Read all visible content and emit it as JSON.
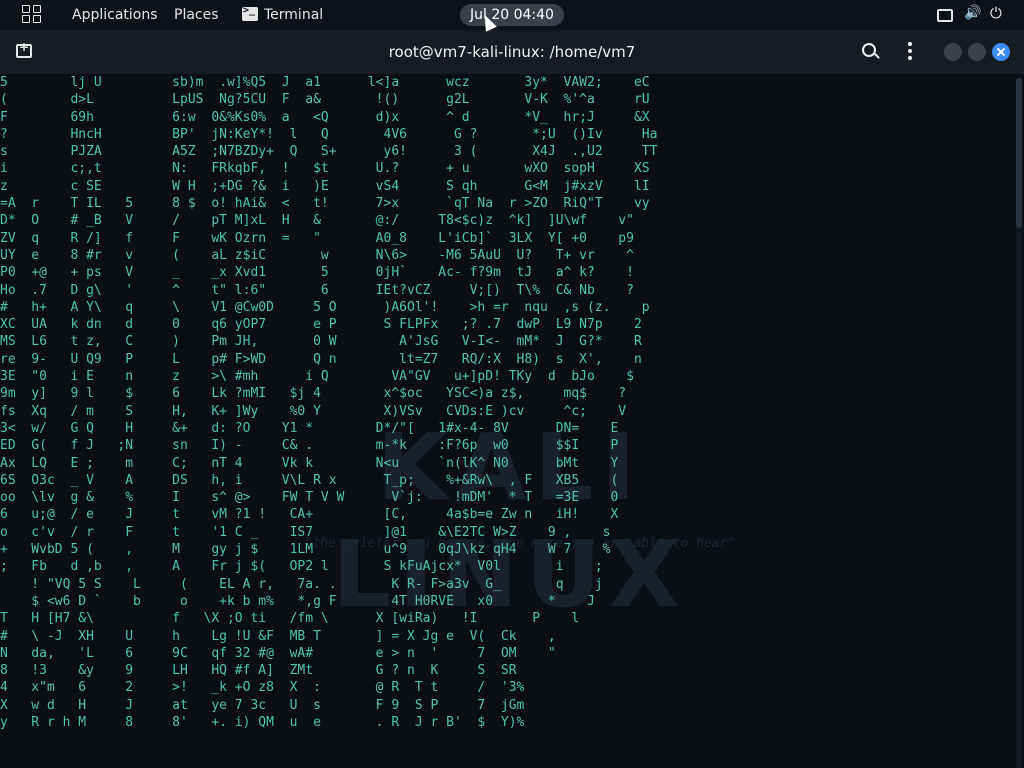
{
  "topbar": {
    "applications": "Applications",
    "places": "Places",
    "terminal_app": "Terminal",
    "clock": "Jul 20  04:40"
  },
  "window": {
    "title": "root@vm7-kali-linux: /home/vm7"
  },
  "terminal": {
    "watermark": "KALI LINUX",
    "watermark_sub": "\"the quieter you become, the more you are able to hear\"",
    "matrix_rows": [
      "5        lj U         sb)m  .w]%Q5  J  a1      l<]a      wcz       3y*  VAW2;    eC",
      "(        d>L          LpUS  Ng?5CU  F  a&       !()      g2L       V-K  %'^a     rU",
      "F        69h          6:w  0&%Ks0%  a   <Q      d)x      ^ d       *V_  hr;J     &X",
      "?        HncH         BP'  jN:KeY*!  l   Q       4V6      G ?       *;U  ()Iv     Ha",
      "s        PJZA         A5Z  ;N7BZDy+  Q   S+      y6!      3 (       X4J  .,U2     TT",
      "i        c;,t         N:   FRkqbF,  !   $t      U.?      + u       wXO  sopH     XS",
      "z        c SE         W H  ;+DG ?&  i   )E      vS4      S qh      G<M  j#xzV    lI",
      "=A  r    T IL   5     8 $  o! hAi&  <   t!      7>x      `qT Na  r >ZO  RiQ\"T    vy",
      "D*  O    # _B   V     /    pT M]xL  H   &       @:/     T8<$c)z  ^k]  ]U\\wf    v\"",
      "ZV  q    R /]   f     F    wK Ozrn  =   \"       A0_8    L'iCb]`  3LX  Y[ +0    p9",
      "UY  e    8 #r   v     (    aL z$iC       w      N\\6>    -M6 5AuU  U?   T+ vr    ^",
      "P0  +@   + ps   V     _    _x Xvd1       5      0jH`    Ac- f?9m  tJ   a^ k?    !",
      "Ho  .7   D g\\   '     ^    t\" l:6\"       6      IEt?vCZ     V;[)  T\\%  C& Nb    ?",
      "#   h+   A Y\\   q     \\    V1 @Cw0D     5 O      )A6Ol'!    >h =r  nqu  ,s (z.    p",
      "XC  UA   k dn   d     0    q6 yOP7      e P      S FLPFx   ;? .7  dwP  L9 N7p    2",
      "MS  L6   t z,   C     )    Pm JH,       0 W        A'JsG   V-I<-  mM*  J  G?*    R",
      "re  9-   U Q9   P     L    p# F>WD      Q n        lt=Z7   RQ/:X  H8)  s  X',    n",
      "3E  \"0   i E    n     z    >\\ #mh      i Q        VA\"GV   u+]pD! TKy  d  bJo    $",
      "9m  y]   9 l    $     6    Lk ?mMI   $j 4        x^$oc   YSC<)a z$,     mq$    ?",
      "fs  Xq   / m    S     H,   K+ ]Wy    %0 Y        X)VSv   CVDs:E )cv     ^c;    V",
      "3<  w/   G Q    H     &+   d: ?O    Y1 *        D*/\"[   1#x-4- 8V      DN=    E",
      "ED  G(   f J   ;N     sn   I) -     C& .        m-*k    :F?6p  w0      $$I    P",
      "Ax  LQ   E ;    m     C;   nT 4     Vk k        N<u     `n(lK^ N0      bMt    Y",
      "6S  O3c  _ V    A     DS   h, i     V\\L R x      T_p;    %+&Rw\\  , F   XB5    (",
      "oo  \\lv  g &    %     I    s^ @>    FW T V W      V`j:    !mDM'  * T   =3E    0",
      "6   u;@  / e    J     t    vM ?1 !   CA+         [C,     4a$b=e Zw n   iH!    X",
      "o   c'v  / r    F     t    '1 C _    IS7         ]@1    &\\E2TC W>Z    9 ,    s",
      "+   WvbD 5 (    ,     M    gy j $    1LM         u^9    0qJ\\kz qH4    W 7    %",
      ";   Fb   d ,b   ,     A    Fr j $(   OP2 l       S kFuAjcx*  V0l       i    ;",
      "    ! \"VQ 5 S    L     (    EL A r,   7a. .       K R- F>a3v  G_       q    j",
      "    $ <w6 D `    b     o    +k b m%   *,g F       4T H0RVE   x0       *    J",
      "T   H [H7 &\\          f   \\X ;O ti   /fm \\      X [wiRa)   !I       P    l",
      "#   \\ -J  XH    U     h    Lg !U &F  MB T       ] = X Jg e  V(  Ck    ,",
      "N   da,   'L    6     9C   qf 32 #@  wA#        e > n  '     7  OM    \"",
      "8   !3    &y    9     LH   HQ #f A]  ZMt        G ? n  K     S  SR",
      "4   x\"m   6     2     >!   _k +O z8  X  :       @ R  T t     /  '3%",
      "X   w d   H     J     at   ye 7 3c   U  s       F 9  S P     7  jGm",
      "y   R r h M     8     8'   +. i) QM  u  e       . R  J r B'  $  Y)%"
    ]
  },
  "colors": {
    "matrix_text": "#4fc3a9",
    "background": "#0b0f14",
    "close_button": "#3a8df5"
  },
  "icons": [
    "app-grid-icon",
    "terminal-icon",
    "screen-icon",
    "volume-icon",
    "power-icon",
    "new-tab-icon",
    "search-icon",
    "kebab-menu-icon",
    "minimize-icon",
    "maximize-icon",
    "close-icon"
  ]
}
